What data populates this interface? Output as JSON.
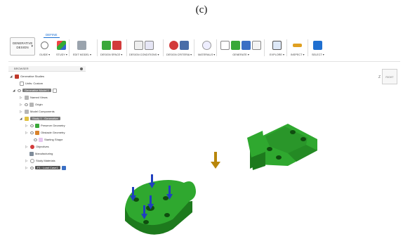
{
  "caption": "(c)",
  "toolbar": {
    "active_tab": "DEFINE",
    "workspace": {
      "line1": "GENERATIVE",
      "line2": "DESIGN"
    },
    "groups": [
      {
        "label": "GUIDE ▾"
      },
      {
        "label": "STUDY ▾"
      },
      {
        "label": "EDIT MODEL ▾"
      },
      {
        "label": "DESIGN SPACE ▾"
      },
      {
        "label": "DESIGN CONDITIONS ▾"
      },
      {
        "label": "DESIGN CRITERIA ▾"
      },
      {
        "label": "MATERIALS ▾"
      },
      {
        "label": "GENERATE ▾"
      },
      {
        "label": "EXPLORE ▾"
      },
      {
        "label": "INSPECT ▾"
      },
      {
        "label": "SELECT ▾"
      }
    ]
  },
  "browser": {
    "header": "BROWSER",
    "items": [
      {
        "label": "Generative Studies"
      },
      {
        "label": "Units: Custom"
      },
      {
        "label": "Generative Model 1"
      },
      {
        "label": "Named Views"
      },
      {
        "label": "Origin"
      },
      {
        "label": "Model Components"
      },
      {
        "label": "Study 1 - Generative"
      },
      {
        "label": "Preserve Geometry"
      },
      {
        "label": "Obstacle Geometry"
      },
      {
        "label": "Starting Shape"
      },
      {
        "label": "Objectives"
      },
      {
        "label": "Manufacturing"
      },
      {
        "label": "Study Materials"
      },
      {
        "label": "F1 : Load Case1"
      }
    ]
  },
  "viewcube": {
    "label": "RIGHT",
    "axis": "Z"
  },
  "colors": {
    "part_green": "#2fa82f",
    "part_dark": "#1d7a1d",
    "load_arrow": "#1f3fbf",
    "gravity_arrow": "#b8860b",
    "accent": "#1a6fd1"
  }
}
